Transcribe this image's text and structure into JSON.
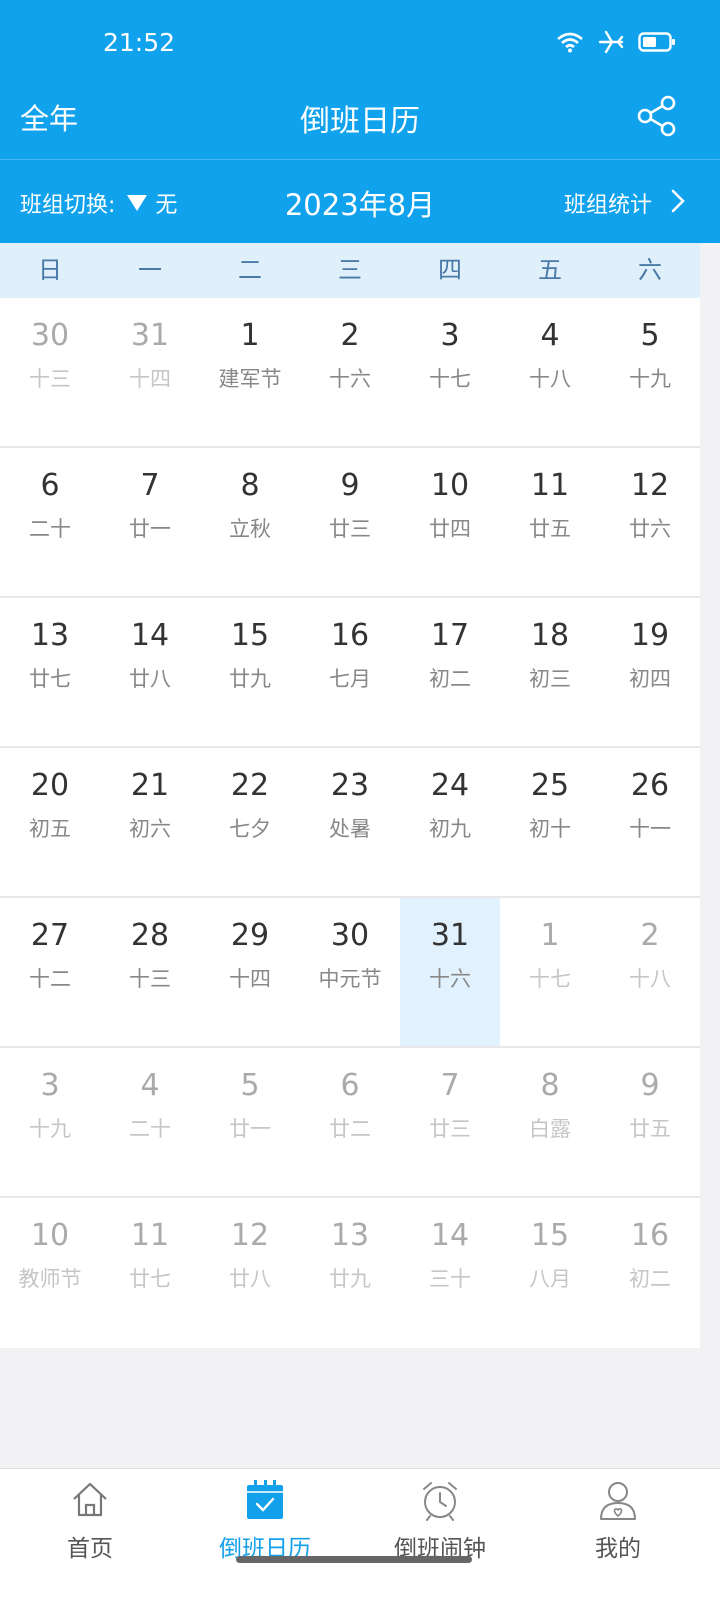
{
  "status": {
    "time": "21:52"
  },
  "header": {
    "left_label": "全年",
    "title": "倒班日历"
  },
  "subbar": {
    "group_label": "班组切换:",
    "group_value": "无",
    "month": "2023年8月",
    "stats_label": "班组统计"
  },
  "weekdays": [
    "日",
    "一",
    "二",
    "三",
    "四",
    "五",
    "六"
  ],
  "calendar": {
    "rows": [
      [
        {
          "d": "30",
          "l": "十三",
          "m": true
        },
        {
          "d": "31",
          "l": "十四",
          "m": true
        },
        {
          "d": "1",
          "l": "建军节"
        },
        {
          "d": "2",
          "l": "十六"
        },
        {
          "d": "3",
          "l": "十七"
        },
        {
          "d": "4",
          "l": "十八"
        },
        {
          "d": "5",
          "l": "十九"
        }
      ],
      [
        {
          "d": "6",
          "l": "二十"
        },
        {
          "d": "7",
          "l": "廿一"
        },
        {
          "d": "8",
          "l": "立秋"
        },
        {
          "d": "9",
          "l": "廿三"
        },
        {
          "d": "10",
          "l": "廿四"
        },
        {
          "d": "11",
          "l": "廿五"
        },
        {
          "d": "12",
          "l": "廿六"
        }
      ],
      [
        {
          "d": "13",
          "l": "廿七"
        },
        {
          "d": "14",
          "l": "廿八"
        },
        {
          "d": "15",
          "l": "廿九"
        },
        {
          "d": "16",
          "l": "七月"
        },
        {
          "d": "17",
          "l": "初二"
        },
        {
          "d": "18",
          "l": "初三"
        },
        {
          "d": "19",
          "l": "初四"
        }
      ],
      [
        {
          "d": "20",
          "l": "初五"
        },
        {
          "d": "21",
          "l": "初六"
        },
        {
          "d": "22",
          "l": "七夕"
        },
        {
          "d": "23",
          "l": "处暑"
        },
        {
          "d": "24",
          "l": "初九"
        },
        {
          "d": "25",
          "l": "初十"
        },
        {
          "d": "26",
          "l": "十一"
        }
      ],
      [
        {
          "d": "27",
          "l": "十二"
        },
        {
          "d": "28",
          "l": "十三"
        },
        {
          "d": "29",
          "l": "十四"
        },
        {
          "d": "30",
          "l": "中元节"
        },
        {
          "d": "31",
          "l": "十六",
          "today": true
        },
        {
          "d": "1",
          "l": "十七",
          "m": true
        },
        {
          "d": "2",
          "l": "十八",
          "m": true
        }
      ],
      [
        {
          "d": "3",
          "l": "十九",
          "m": true
        },
        {
          "d": "4",
          "l": "二十",
          "m": true
        },
        {
          "d": "5",
          "l": "廿一",
          "m": true
        },
        {
          "d": "6",
          "l": "廿二",
          "m": true
        },
        {
          "d": "7",
          "l": "廿三",
          "m": true
        },
        {
          "d": "8",
          "l": "白露",
          "m": true
        },
        {
          "d": "9",
          "l": "廿五",
          "m": true
        }
      ],
      [
        {
          "d": "10",
          "l": "教师节",
          "m": true
        },
        {
          "d": "11",
          "l": "廿七",
          "m": true
        },
        {
          "d": "12",
          "l": "廿八",
          "m": true
        },
        {
          "d": "13",
          "l": "廿九",
          "m": true
        },
        {
          "d": "14",
          "l": "三十",
          "m": true
        },
        {
          "d": "15",
          "l": "八月",
          "m": true
        },
        {
          "d": "16",
          "l": "初二",
          "m": true
        }
      ]
    ]
  },
  "tabs": [
    {
      "label": "首页",
      "icon": "home-icon"
    },
    {
      "label": "倒班日历",
      "icon": "calendar-icon",
      "active": true
    },
    {
      "label": "倒班闹钟",
      "icon": "alarm-clock-icon"
    },
    {
      "label": "我的",
      "icon": "user-icon"
    }
  ],
  "colors": {
    "primary": "#10a2ec",
    "today": "#e1f1fd",
    "weekhead": "#dff0fb"
  }
}
